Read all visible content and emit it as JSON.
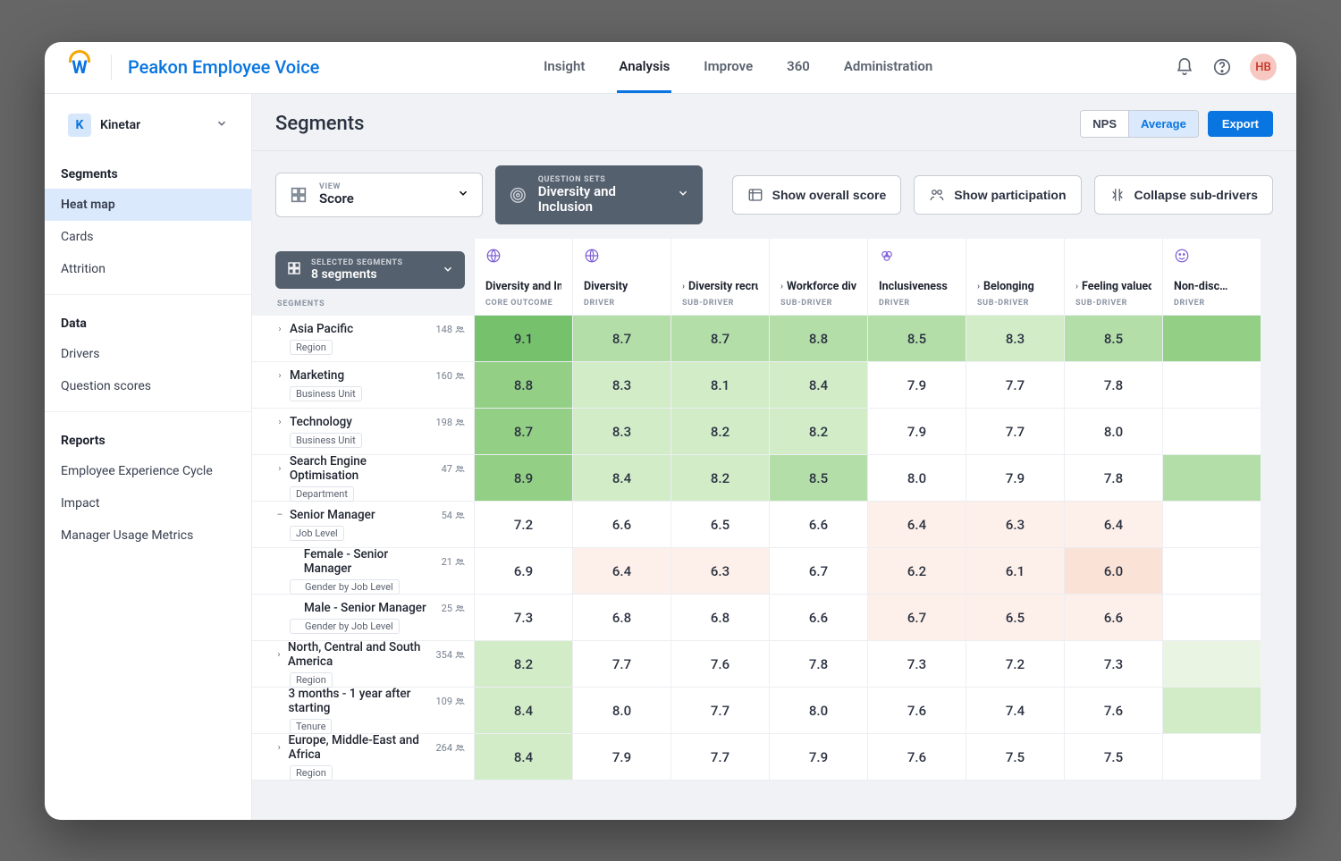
{
  "brand": {
    "app_title": "Peakon Employee Voice"
  },
  "topnav": {
    "items": [
      "Insight",
      "Analysis",
      "Improve",
      "360",
      "Administration"
    ],
    "active_index": 1
  },
  "user": {
    "initials": "HB"
  },
  "company": {
    "badge": "K",
    "name": "Kinetar"
  },
  "sidebar": {
    "sections": [
      {
        "title": "Segments",
        "items": [
          "Heat map",
          "Cards",
          "Attrition"
        ],
        "active_index": 0
      },
      {
        "title": "Data",
        "items": [
          "Drivers",
          "Question scores"
        ],
        "active_index": -1
      },
      {
        "title": "Reports",
        "items": [
          "Employee Experience Cycle",
          "Impact",
          "Manager Usage Metrics"
        ],
        "active_index": -1
      }
    ]
  },
  "page": {
    "title": "Segments"
  },
  "header_toggle": {
    "options": [
      "NPS",
      "Average"
    ],
    "active_index": 1,
    "export_label": "Export"
  },
  "toolbar": {
    "view": {
      "label": "VIEW",
      "value": "Score"
    },
    "question_set": {
      "label": "QUESTION SETS",
      "value": "Diversity and Inclusion"
    },
    "buttons": {
      "overall": "Show overall score",
      "participation": "Show participation",
      "collapse": "Collapse sub-drivers"
    }
  },
  "segments_selector": {
    "label": "SELECTED SEGMENTS",
    "value": "8 segments"
  },
  "segments_col_label": "SEGMENTS",
  "columns": [
    {
      "name": "Diversity and Inclu…",
      "type": "CORE OUTCOME",
      "icon": "diversity"
    },
    {
      "name": "Diversity",
      "type": "DRIVER",
      "icon": "globe"
    },
    {
      "name": "Diversity recruit…",
      "type": "SUB-DRIVER",
      "sub": true
    },
    {
      "name": "Workforce divers…",
      "type": "SUB-DRIVER",
      "sub": true
    },
    {
      "name": "Inclusiveness",
      "type": "DRIVER",
      "icon": "rings"
    },
    {
      "name": "Belonging",
      "type": "SUB-DRIVER",
      "sub": true
    },
    {
      "name": "Feeling valued",
      "type": "SUB-DRIVER",
      "sub": true
    },
    {
      "name": "Non-disc…",
      "type": "DRIVER",
      "icon": "smile"
    }
  ],
  "rows": [
    {
      "expander": "›",
      "name": "Asia Pacific",
      "tag": "Region",
      "count": 148,
      "cells": [
        {
          "v": "9.1",
          "c": "c-g4"
        },
        {
          "v": "8.7",
          "c": "c-g2"
        },
        {
          "v": "8.7",
          "c": "c-g2"
        },
        {
          "v": "8.8",
          "c": "c-g2"
        },
        {
          "v": "8.5",
          "c": "c-g2"
        },
        {
          "v": "8.3",
          "c": "c-g1"
        },
        {
          "v": "8.5",
          "c": "c-g2"
        },
        {
          "v": "",
          "c": "c-g3"
        }
      ]
    },
    {
      "expander": "›",
      "name": "Marketing",
      "tag": "Business Unit",
      "count": 160,
      "cells": [
        {
          "v": "8.8",
          "c": "c-g3"
        },
        {
          "v": "8.3",
          "c": "c-g1"
        },
        {
          "v": "8.1",
          "c": "c-g1"
        },
        {
          "v": "8.4",
          "c": "c-g1"
        },
        {
          "v": "7.9",
          "c": "c-w"
        },
        {
          "v": "7.7",
          "c": "c-w"
        },
        {
          "v": "7.8",
          "c": "c-w"
        },
        {
          "v": "",
          "c": "c-w"
        }
      ]
    },
    {
      "expander": "›",
      "name": "Technology",
      "tag": "Business Unit",
      "count": 198,
      "cells": [
        {
          "v": "8.7",
          "c": "c-g3"
        },
        {
          "v": "8.3",
          "c": "c-g1"
        },
        {
          "v": "8.2",
          "c": "c-g1"
        },
        {
          "v": "8.2",
          "c": "c-g1"
        },
        {
          "v": "7.9",
          "c": "c-w"
        },
        {
          "v": "7.7",
          "c": "c-w"
        },
        {
          "v": "8.0",
          "c": "c-w"
        },
        {
          "v": "",
          "c": "c-w"
        }
      ]
    },
    {
      "expander": "›",
      "name": "Search Engine Optimisation",
      "tag": "Department",
      "count": 47,
      "cells": [
        {
          "v": "8.9",
          "c": "c-g3"
        },
        {
          "v": "8.4",
          "c": "c-g1"
        },
        {
          "v": "8.2",
          "c": "c-g1"
        },
        {
          "v": "8.5",
          "c": "c-g2"
        },
        {
          "v": "8.0",
          "c": "c-w"
        },
        {
          "v": "7.9",
          "c": "c-w"
        },
        {
          "v": "7.8",
          "c": "c-w"
        },
        {
          "v": "",
          "c": "c-g2"
        }
      ]
    },
    {
      "expander": "–",
      "name": "Senior Manager",
      "tag": "Job Level",
      "count": 54,
      "cells": [
        {
          "v": "7.2",
          "c": "c-w"
        },
        {
          "v": "6.6",
          "c": "c-w"
        },
        {
          "v": "6.5",
          "c": "c-w"
        },
        {
          "v": "6.6",
          "c": "c-w"
        },
        {
          "v": "6.4",
          "c": "c-r0"
        },
        {
          "v": "6.3",
          "c": "c-r0"
        },
        {
          "v": "6.4",
          "c": "c-r0"
        },
        {
          "v": "",
          "c": "c-w"
        }
      ]
    },
    {
      "expander": "",
      "name": "Female - Senior Manager",
      "tag": "Gender by Job Level",
      "count": 21,
      "indent": true,
      "cells": [
        {
          "v": "6.9",
          "c": "c-w"
        },
        {
          "v": "6.4",
          "c": "c-r0"
        },
        {
          "v": "6.3",
          "c": "c-r0"
        },
        {
          "v": "6.7",
          "c": "c-w"
        },
        {
          "v": "6.2",
          "c": "c-r0"
        },
        {
          "v": "6.1",
          "c": "c-r0"
        },
        {
          "v": "6.0",
          "c": "c-r1"
        },
        {
          "v": "",
          "c": "c-w"
        }
      ]
    },
    {
      "expander": "",
      "name": "Male - Senior Manager",
      "tag": "Gender by Job Level",
      "count": 25,
      "indent": true,
      "cells": [
        {
          "v": "7.3",
          "c": "c-w"
        },
        {
          "v": "6.8",
          "c": "c-w"
        },
        {
          "v": "6.8",
          "c": "c-w"
        },
        {
          "v": "6.6",
          "c": "c-w"
        },
        {
          "v": "6.7",
          "c": "c-r0"
        },
        {
          "v": "6.5",
          "c": "c-r0"
        },
        {
          "v": "6.6",
          "c": "c-r0"
        },
        {
          "v": "",
          "c": "c-w"
        }
      ]
    },
    {
      "expander": "›",
      "name": "North, Central and South America",
      "tag": "Region",
      "count": 354,
      "cells": [
        {
          "v": "8.2",
          "c": "c-g1"
        },
        {
          "v": "7.7",
          "c": "c-w"
        },
        {
          "v": "7.6",
          "c": "c-w"
        },
        {
          "v": "7.8",
          "c": "c-w"
        },
        {
          "v": "7.3",
          "c": "c-w"
        },
        {
          "v": "7.2",
          "c": "c-w"
        },
        {
          "v": "7.3",
          "c": "c-w"
        },
        {
          "v": "",
          "c": "c-g0"
        }
      ]
    },
    {
      "expander": "",
      "name": "3 months - 1 year after starting",
      "tag": "Tenure",
      "count": 109,
      "cells": [
        {
          "v": "8.4",
          "c": "c-g1"
        },
        {
          "v": "8.0",
          "c": "c-w"
        },
        {
          "v": "7.7",
          "c": "c-w"
        },
        {
          "v": "8.0",
          "c": "c-w"
        },
        {
          "v": "7.6",
          "c": "c-w"
        },
        {
          "v": "7.4",
          "c": "c-w"
        },
        {
          "v": "7.6",
          "c": "c-w"
        },
        {
          "v": "",
          "c": "c-g1"
        }
      ]
    },
    {
      "expander": "›",
      "name": "Europe, Middle-East and Africa",
      "tag": "Region",
      "count": 264,
      "cells": [
        {
          "v": "8.4",
          "c": "c-g1"
        },
        {
          "v": "7.9",
          "c": "c-w"
        },
        {
          "v": "7.7",
          "c": "c-w"
        },
        {
          "v": "7.9",
          "c": "c-w"
        },
        {
          "v": "7.6",
          "c": "c-w"
        },
        {
          "v": "7.5",
          "c": "c-w"
        },
        {
          "v": "7.5",
          "c": "c-w"
        },
        {
          "v": "",
          "c": "c-w"
        }
      ]
    }
  ],
  "chart_data": {
    "type": "heatmap",
    "title": "Segments — Diversity and Inclusion scores (Average)",
    "x_categories": [
      "Diversity and Inclusion",
      "Diversity",
      "Diversity recruitment",
      "Workforce diversity",
      "Inclusiveness",
      "Belonging",
      "Feeling valued"
    ],
    "y_categories": [
      "Asia Pacific",
      "Marketing",
      "Technology",
      "Search Engine Optimisation",
      "Senior Manager",
      "Female - Senior Manager",
      "Male - Senior Manager",
      "North, Central and South America",
      "3 months - 1 year after starting",
      "Europe, Middle-East and Africa"
    ],
    "values": [
      [
        9.1,
        8.7,
        8.7,
        8.8,
        8.5,
        8.3,
        8.5
      ],
      [
        8.8,
        8.3,
        8.1,
        8.4,
        7.9,
        7.7,
        7.8
      ],
      [
        8.7,
        8.3,
        8.2,
        8.2,
        7.9,
        7.7,
        8.0
      ],
      [
        8.9,
        8.4,
        8.2,
        8.5,
        8.0,
        7.9,
        7.8
      ],
      [
        7.2,
        6.6,
        6.5,
        6.6,
        6.4,
        6.3,
        6.4
      ],
      [
        6.9,
        6.4,
        6.3,
        6.7,
        6.2,
        6.1,
        6.0
      ],
      [
        7.3,
        6.8,
        6.8,
        6.6,
        6.7,
        6.5,
        6.6
      ],
      [
        8.2,
        7.7,
        7.6,
        7.8,
        7.3,
        7.2,
        7.3
      ],
      [
        8.4,
        8.0,
        7.7,
        8.0,
        7.6,
        7.4,
        7.6
      ],
      [
        8.4,
        7.9,
        7.7,
        7.9,
        7.6,
        7.5,
        7.5
      ]
    ],
    "value_range": [
      6.0,
      9.1
    ]
  }
}
